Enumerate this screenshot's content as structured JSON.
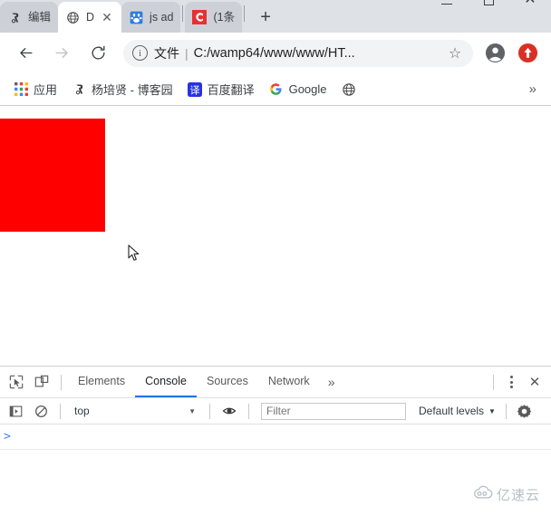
{
  "window": {
    "controls": {
      "minimize": "minimize-button",
      "maximize": "maximize-button",
      "close": "close-button"
    }
  },
  "tabs": [
    {
      "title": "编辑",
      "icon": "cnblogs-icon",
      "active": false,
      "closable": false
    },
    {
      "title": "D",
      "icon": "globe-icon",
      "active": true,
      "closable": true,
      "close_label": "✕"
    },
    {
      "title": "js ad",
      "icon": "baidu-icon",
      "active": false,
      "closable": false
    },
    {
      "title": "(1条",
      "icon": "csdn-icon",
      "active": false,
      "closable": false
    }
  ],
  "new_tab_label": "+",
  "toolbar": {
    "back_label": "←",
    "forward_label": "→",
    "reload_label": "⟳",
    "info_label": "i",
    "scheme_label": "文件",
    "separator": "|",
    "url": "C:/wamp64/www/www/HT...",
    "star_label": "☆",
    "profile_icon": "profile-avatar-icon",
    "extension_icon": "extension-red-icon"
  },
  "bookmarks": {
    "items": [
      {
        "label": "应用",
        "icon": "apps-grid-icon"
      },
      {
        "label": "杨培贤 - 博客园",
        "icon": "cnblogs-icon"
      },
      {
        "label": "百度翻译",
        "icon": "translate-icon",
        "icon_text": "译"
      },
      {
        "label": "Google",
        "icon": "google-g-icon"
      },
      {
        "label": "",
        "icon": "globe-icon"
      }
    ],
    "overflow_label": "»"
  },
  "page": {
    "red_box_color": "#FF0000",
    "background": "#FFFFFF"
  },
  "devtools": {
    "inspect_icon": "inspect-element-icon",
    "device_icon": "device-toolbar-icon",
    "tabs": [
      {
        "label": "Elements",
        "active": false
      },
      {
        "label": "Console",
        "active": true
      },
      {
        "label": "Sources",
        "active": false
      },
      {
        "label": "Network",
        "active": false
      }
    ],
    "more_tabs_label": "»",
    "kebab_label": "more-options",
    "close_label": "✕",
    "console": {
      "sidebar_toggle_icon": "console-sidebar-toggle-icon",
      "clear_icon": "clear-console-icon",
      "context_value": "top",
      "context_caret": "▼",
      "eye_icon": "live-expression-eye-icon",
      "filter_placeholder": "Filter",
      "filter_value": "",
      "levels_label": "Default levels",
      "levels_caret": "▼",
      "settings_icon": "console-settings-gear-icon",
      "prompt_symbol": ">"
    }
  },
  "watermark": {
    "text": "亿速云",
    "icon": "cloud-logo-icon",
    "color": "#b6bcc4"
  },
  "colors": {
    "accent": "#1a73e8",
    "tabstrip_bg": "#dee1e6",
    "inactive_tab_bg": "#cdd1d7",
    "omnibox_bg": "#f1f3f4",
    "red": "#FF0000"
  }
}
